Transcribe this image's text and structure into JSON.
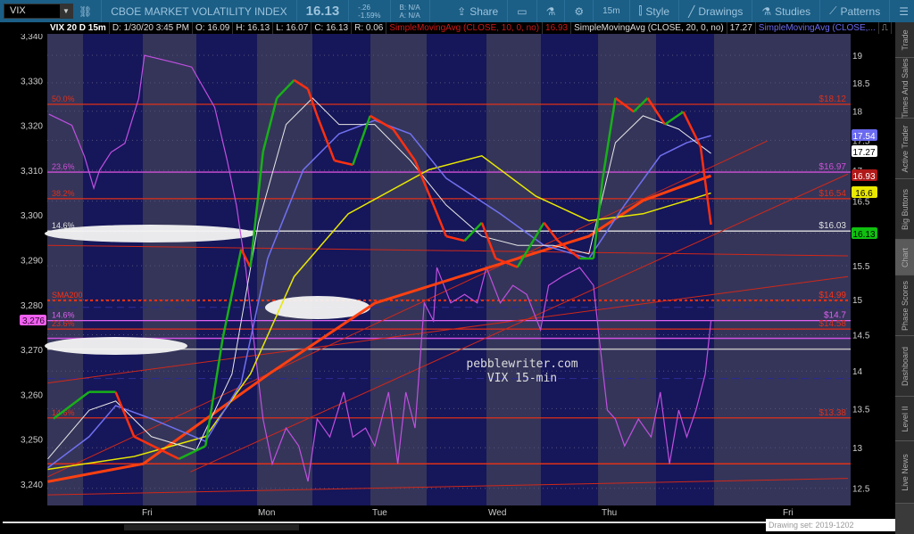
{
  "toolbar": {
    "symbol": "VIX",
    "description": "CBOE MARKET VOLATILITY INDEX",
    "last": "16.13",
    "change": "-.26",
    "change_pct": "-1.59%",
    "bid": "B: N/A",
    "ask": "A: N/A",
    "share": "Share",
    "timeframe": "15m",
    "style": "Style",
    "drawings": "Drawings",
    "studies": "Studies",
    "patterns": "Patterns"
  },
  "legend": {
    "title": "VIX 20 D 15m",
    "date": "D: 1/30/20 3:45 PM",
    "open": "O: 16.09",
    "high": "H: 16.13",
    "low": "L: 16.07",
    "close": "C: 16.13",
    "range": "R: 0.06",
    "sma10": "SimpleMovingAvg (CLOSE, 10, 0, no)",
    "sma10_val": "16.93",
    "sma20": "SimpleMovingAvg (CLOSE, 20, 0, no)",
    "sma20_val": "17.27",
    "sma50": "SimpleMovingAvg (CLOSE,..."
  },
  "sidebar": {
    "tabs": [
      "Trade",
      "Times And Sales",
      "Active Trader",
      "Big Buttons",
      "Chart",
      "Phase Scores",
      "Dashboard",
      "Level II",
      "Live News"
    ]
  },
  "bottom": {
    "drawing_set": "Drawing set: 2019-1202"
  },
  "watermark": {
    "line1": "pebblewriter.com",
    "line2": "VIX 15-min"
  },
  "chart_data": {
    "type": "line",
    "x_labels": [
      "Fri",
      "Mon",
      "Tue",
      "Wed",
      "Thu",
      "Fri"
    ],
    "left_axis": {
      "min": 3240,
      "max": 3340,
      "ticks": [
        "3,340",
        "3,330",
        "3,320",
        "3,310",
        "3,300",
        "3,290",
        "3,280",
        "3,270",
        "3,260",
        "3,250",
        "3,240"
      ],
      "marker": "3,276"
    },
    "right_axis": {
      "scale": "log",
      "ticks": [
        "19",
        "18.5",
        "18",
        "17.5",
        "17",
        "16.5",
        "16",
        "15.5",
        "15",
        "14.5",
        "14",
        "13.5",
        "13",
        "12.5"
      ]
    },
    "badges": [
      {
        "label": "17.54",
        "color": "#6a6af0"
      },
      {
        "label": "17.27",
        "color": "#ffffff"
      },
      {
        "label": "16.93",
        "color": "#b01818"
      },
      {
        "label": "16.6",
        "color": "#e8e800"
      },
      {
        "label": "16.13",
        "color": "#10c010"
      }
    ],
    "levels": [
      {
        "value": 18.12,
        "label": "$18.12",
        "left": "50.0%",
        "color": "#e03018"
      },
      {
        "value": 16.97,
        "label": "$16.97",
        "left": "23.6%",
        "color": "#d050d8"
      },
      {
        "value": 16.54,
        "label": "$16.54",
        "left": "38.2%",
        "color": "#e03018"
      },
      {
        "value": 16.03,
        "label": "$16.03",
        "left": "14.6%",
        "color": "#e0e0e0"
      },
      {
        "value": 14.99,
        "label": "$14.99",
        "left": "SMA200",
        "color": "#ff3010",
        "dotted": true
      },
      {
        "value": 14.7,
        "label": "$14.7",
        "left": "14.6%",
        "color": "#e060f0"
      },
      {
        "value": 14.58,
        "label": "$14.58",
        "left": "23.6%",
        "color": "#e03018"
      },
      {
        "value": 13.38,
        "label": "$13.38",
        "left": "14.6%",
        "color": "#e03018"
      }
    ],
    "extra_lines": [
      {
        "value": 14.3,
        "color": "#c0c0c0"
      },
      {
        "value": 14.45,
        "color": "#d050e0"
      },
      {
        "value": 12.8,
        "color": "#e03018"
      },
      {
        "value": 14.89,
        "color": "#2a2a90",
        "dashed": true
      },
      {
        "value": 13.9,
        "color": "#2a2a90",
        "dashed": true
      }
    ],
    "trendlines": [
      [
        [
          -0.88,
          12.64
        ],
        [
          5.37,
          17.49
        ]
      ],
      [
        [
          -0.88,
          13.84
        ],
        [
          6.07,
          15.34
        ]
      ],
      [
        [
          0.36,
          12.7
        ],
        [
          6.07,
          16.94
        ]
      ],
      [
        [
          -0.88,
          12.42
        ],
        [
          6.07,
          12.62
        ]
      ],
      [
        [
          -0.88,
          15.81
        ],
        [
          6.07,
          15.65
        ]
      ]
    ],
    "series": [
      {
        "name": "SPX",
        "axis": "left",
        "color": "#c050e0",
        "width": 1.2,
        "points": [
          [
            -0.87,
            3322.5
          ],
          [
            -0.67,
            3320
          ],
          [
            -0.56,
            3313
          ],
          [
            -0.48,
            3306
          ],
          [
            -0.43,
            3310
          ],
          [
            -0.33,
            3314
          ],
          [
            -0.21,
            3316
          ],
          [
            -0.09,
            3326
          ],
          [
            -0.04,
            3335.6
          ],
          [
            0.06,
            3335
          ],
          [
            0.22,
            3334
          ],
          [
            0.37,
            3333
          ],
          [
            0.57,
            3324
          ],
          [
            0.68,
            3312
          ],
          [
            0.76,
            3302
          ],
          [
            0.84,
            3288
          ],
          [
            0.91,
            3272
          ],
          [
            0.99,
            3254.5
          ],
          [
            1.07,
            3244.5
          ],
          [
            1.19,
            3252.5
          ],
          [
            1.3,
            3248.5
          ],
          [
            1.38,
            3240.6
          ],
          [
            1.46,
            3254.5
          ],
          [
            1.57,
            3250.5
          ],
          [
            1.69,
            3260.5
          ],
          [
            1.77,
            3250.5
          ],
          [
            1.88,
            3252.5
          ],
          [
            1.96,
            3248.5
          ],
          [
            2.08,
            3260.5
          ],
          [
            2.16,
            3244.5
          ],
          [
            2.23,
            3260.5
          ],
          [
            2.31,
            3252.5
          ],
          [
            2.39,
            3280.4
          ],
          [
            2.47,
            3276.4
          ],
          [
            2.5,
            3288.3
          ],
          [
            2.62,
            3280.4
          ],
          [
            2.74,
            3282.3
          ],
          [
            2.85,
            3280.4
          ],
          [
            2.93,
            3288.3
          ],
          [
            3.05,
            3280.4
          ],
          [
            3.16,
            3284.3
          ],
          [
            3.28,
            3282.3
          ],
          [
            3.4,
            3274.4
          ],
          [
            3.47,
            3284.3
          ],
          [
            3.59,
            3286.3
          ],
          [
            3.74,
            3288.3
          ],
          [
            3.86,
            3284.3
          ],
          [
            3.91,
            3272.4
          ],
          [
            3.98,
            3256.5
          ],
          [
            4.05,
            3254.5
          ],
          [
            4.13,
            3248.5
          ],
          [
            4.25,
            3254.5
          ],
          [
            4.36,
            3250.5
          ],
          [
            4.44,
            3260.5
          ],
          [
            4.52,
            3244.5
          ],
          [
            4.6,
            3256.5
          ],
          [
            4.67,
            3250.5
          ],
          [
            4.75,
            3256.5
          ],
          [
            4.83,
            3264.5
          ],
          [
            4.88,
            3276.4
          ]
        ]
      },
      {
        "name": "SMA thick",
        "axis": "right",
        "color": "#ff4010",
        "width": 3,
        "points": [
          [
            -0.88,
            12.58
          ],
          [
            -0.05,
            12.8
          ],
          [
            1.04,
            13.96
          ],
          [
            1.96,
            14.95
          ],
          [
            2.96,
            15.48
          ],
          [
            3.82,
            15.95
          ],
          [
            4.29,
            16.51
          ],
          [
            4.88,
            16.91
          ]
        ]
      },
      {
        "name": "SMA yellow",
        "axis": "right",
        "color": "#e8e800",
        "width": 1.5,
        "points": [
          [
            -0.88,
            12.73
          ],
          [
            -0.13,
            12.89
          ],
          [
            0.49,
            13.14
          ],
          [
            0.88,
            13.96
          ],
          [
            1.26,
            15.34
          ],
          [
            1.73,
            16.3
          ],
          [
            2.43,
            17.01
          ],
          [
            2.89,
            17.24
          ],
          [
            3.36,
            16.58
          ],
          [
            3.82,
            16.19
          ],
          [
            4.29,
            16.3
          ],
          [
            4.67,
            16.51
          ],
          [
            4.88,
            16.63
          ]
        ]
      },
      {
        "name": "SMA50",
        "axis": "right",
        "color": "#7070f0",
        "width": 1.5,
        "points": [
          [
            -0.88,
            12.75
          ],
          [
            -0.52,
            13.14
          ],
          [
            -0.29,
            13.54
          ],
          [
            0.02,
            13.37
          ],
          [
            0.49,
            13.08
          ],
          [
            0.8,
            13.84
          ],
          [
            1.03,
            15.61
          ],
          [
            1.34,
            17.01
          ],
          [
            1.65,
            17.61
          ],
          [
            1.96,
            17.84
          ],
          [
            2.27,
            17.61
          ],
          [
            2.58,
            16.87
          ],
          [
            3.05,
            16.3
          ],
          [
            3.43,
            15.81
          ],
          [
            3.82,
            15.61
          ],
          [
            4.13,
            16.44
          ],
          [
            4.44,
            17.24
          ],
          [
            4.67,
            17.46
          ],
          [
            4.88,
            17.58
          ]
        ]
      },
      {
        "name": "SMA20",
        "axis": "right",
        "color": "#e8e8e8",
        "width": 1,
        "points": [
          [
            -0.88,
            12.86
          ],
          [
            -0.52,
            13.48
          ],
          [
            -0.29,
            13.6
          ],
          [
            0.02,
            13.14
          ],
          [
            0.41,
            12.97
          ],
          [
            0.72,
            13.96
          ],
          [
            0.95,
            16.16
          ],
          [
            1.19,
            17.77
          ],
          [
            1.42,
            18.23
          ],
          [
            1.65,
            17.77
          ],
          [
            1.96,
            17.77
          ],
          [
            2.27,
            17.16
          ],
          [
            2.58,
            16.44
          ],
          [
            2.89,
            15.95
          ],
          [
            3.2,
            15.81
          ],
          [
            3.51,
            15.81
          ],
          [
            3.82,
            15.68
          ],
          [
            4.05,
            17.46
          ],
          [
            4.29,
            17.92
          ],
          [
            4.6,
            17.69
          ],
          [
            4.88,
            17.28
          ]
        ]
      },
      {
        "name": "VIX",
        "axis": "right",
        "candles": true,
        "points": [
          [
            -0.83,
            13.37
          ],
          [
            -0.52,
            13.72
          ],
          [
            -0.29,
            13.72
          ],
          [
            -0.13,
            13.14
          ],
          [
            0.26,
            12.86
          ],
          [
            0.49,
            13.02
          ],
          [
            0.64,
            14.45
          ],
          [
            0.8,
            15.75
          ],
          [
            0.88,
            15.48
          ],
          [
            0.99,
            17.31
          ],
          [
            1.11,
            18.23
          ],
          [
            1.26,
            18.55
          ],
          [
            1.38,
            18.39
          ],
          [
            1.46,
            17.92
          ],
          [
            1.61,
            17.16
          ],
          [
            1.77,
            17.09
          ],
          [
            1.92,
            17.92
          ],
          [
            2.12,
            17.69
          ],
          [
            2.31,
            17.16
          ],
          [
            2.47,
            16.44
          ],
          [
            2.58,
            15.95
          ],
          [
            2.74,
            15.88
          ],
          [
            2.89,
            16.16
          ],
          [
            3.01,
            15.61
          ],
          [
            3.2,
            15.48
          ],
          [
            3.43,
            16.16
          ],
          [
            3.55,
            15.88
          ],
          [
            3.74,
            15.61
          ],
          [
            3.86,
            15.61
          ],
          [
            3.94,
            16.87
          ],
          [
            4.05,
            18.23
          ],
          [
            4.21,
            17.99
          ],
          [
            4.33,
            18.23
          ],
          [
            4.48,
            17.77
          ],
          [
            4.64,
            17.99
          ],
          [
            4.79,
            17.39
          ],
          [
            4.88,
            16.13
          ]
        ]
      }
    ]
  }
}
